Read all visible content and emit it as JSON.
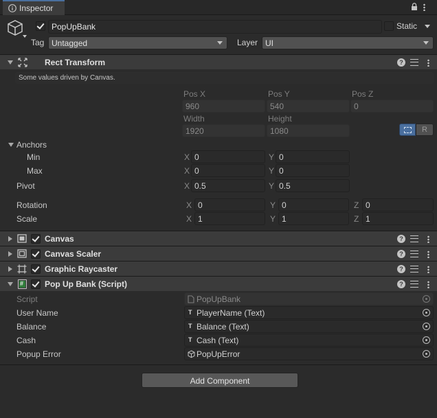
{
  "window": {
    "tab_title": "Inspector"
  },
  "header": {
    "object_name": "PopUpBank",
    "active": true,
    "static_label": "Static",
    "static_checked": false,
    "tag_label": "Tag",
    "tag_value": "Untagged",
    "layer_label": "Layer",
    "layer_value": "UI"
  },
  "rect_transform": {
    "title": "Rect Transform",
    "note": "Some values driven by Canvas.",
    "pos_x_label": "Pos X",
    "pos_x": "960",
    "pos_y_label": "Pos Y",
    "pos_y": "540",
    "pos_z_label": "Pos Z",
    "pos_z": "0",
    "width_label": "Width",
    "width": "1920",
    "height_label": "Height",
    "height": "1080",
    "r_button": "R",
    "anchors_label": "Anchors",
    "min_label": "Min",
    "min_x": "0",
    "min_y": "0",
    "max_label": "Max",
    "max_x": "0",
    "max_y": "0",
    "pivot_label": "Pivot",
    "pivot_x": "0.5",
    "pivot_y": "0.5",
    "rotation_label": "Rotation",
    "rot_x": "0",
    "rot_y": "0",
    "rot_z": "0",
    "scale_label": "Scale",
    "scale_x": "1",
    "scale_y": "1",
    "scale_z": "1",
    "x": "X",
    "y": "Y",
    "z": "Z"
  },
  "components": [
    {
      "name": "Canvas",
      "enabled": true
    },
    {
      "name": "Canvas Scaler",
      "enabled": true
    },
    {
      "name": "Graphic Raycaster",
      "enabled": true
    }
  ],
  "script_component": {
    "title": "Pop Up Bank (Script)",
    "enabled": true,
    "fields": [
      {
        "label": "Script",
        "value": "PopUpBank",
        "readonly": true
      },
      {
        "label": "User Name",
        "value": "PlayerName (Text)"
      },
      {
        "label": "Balance",
        "value": "Balance (Text)"
      },
      {
        "label": "Cash",
        "value": "Cash (Text)"
      },
      {
        "label": "Popup Error",
        "value": "PopUpError"
      }
    ]
  },
  "add_component_label": "Add Component",
  "colors": {
    "background": "#2b2b2b",
    "header": "#3b3b3b",
    "accent": "#4a6f9e"
  }
}
